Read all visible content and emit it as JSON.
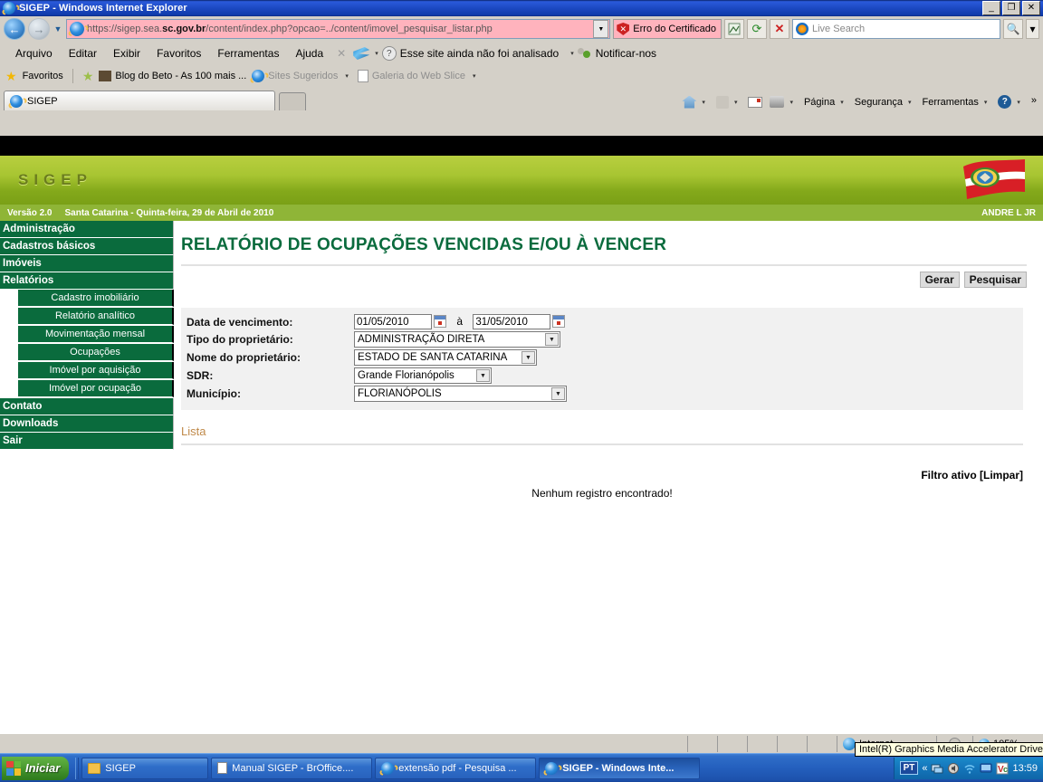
{
  "window": {
    "title": "SIGEP - Windows Internet Explorer",
    "minimize_label": "_",
    "restore_label": "❐",
    "close_label": "✕"
  },
  "browser": {
    "back_label": "←",
    "forward_label": "→",
    "history_caret": "▼",
    "url_prefix": "https://sigep.sea.",
    "url_host_bold": "sc.gov.br",
    "url_suffix": "/content/index.php?opcao=../content/imovel_pesquisar_listar.php",
    "url_dropdown": "▼",
    "certificate_error": "Erro do Certificado",
    "compat_icon": "compatibility-view-icon",
    "refresh_icon": "↻",
    "stop_icon": "✕",
    "search_placeholder": "Live Search",
    "search_go": "🔍",
    "search_caret": "▾",
    "menu": [
      "Arquivo",
      "Editar",
      "Exibir",
      "Favoritos",
      "Ferramentas",
      "Ajuda"
    ],
    "toolbar_close": "✕",
    "site_rating": "Esse site ainda não foi analisado",
    "notify_us": "Notificar-nos",
    "favorites_label": "Favoritos",
    "favorites_items": [
      "Blog do Beto - As 100 mais ...",
      "Sites Sugeridos",
      "Galeria do Web Slice"
    ],
    "tab_title": "SIGEP",
    "new_tab_label": "",
    "command_bar": [
      "Página",
      "Segurança",
      "Ferramentas"
    ],
    "command_overflow": "»"
  },
  "app": {
    "logo": "SIGEP",
    "version": "Versão 2.0",
    "location_date": "Santa Catarina - Quinta-feira, 29 de Abril de 2010",
    "user": "ANDRE L JR"
  },
  "sidebar": {
    "items": [
      {
        "label": "Administração"
      },
      {
        "label": "Cadastros básicos"
      },
      {
        "label": "Imóveis"
      },
      {
        "label": "Relatórios"
      }
    ],
    "submenu": [
      {
        "label": "Cadastro imobiliário"
      },
      {
        "label": "Relatório analítico"
      },
      {
        "label": "Movimentação mensal"
      },
      {
        "label": "Ocupações"
      },
      {
        "label": "Imóvel por aquisição"
      },
      {
        "label": "Imóvel por ocupação"
      }
    ],
    "bottom_items": [
      {
        "label": "Contato"
      },
      {
        "label": "Downloads"
      },
      {
        "label": "Sair"
      }
    ]
  },
  "main": {
    "title": "RELATÓRIO DE OCUPAÇÕES VENCIDAS E/OU À VENCER",
    "buttons": {
      "gerar": "Gerar",
      "pesquisar": "Pesquisar"
    },
    "form": {
      "date_label": "Data de vencimento:",
      "date_from": "01/05/2010",
      "date_separator": "à",
      "date_to": "31/05/2010",
      "owner_type_label": "Tipo do proprietário:",
      "owner_type_value": "ADMINISTRAÇÃO DIRETA",
      "owner_name_label": "Nome do proprietário:",
      "owner_name_value": "ESTADO DE SANTA CATARINA",
      "sdr_label": "SDR:",
      "sdr_value": "Grande Florianópolis",
      "municipality_label": "Município:",
      "municipality_value": "FLORIANÓPOLIS",
      "select_arrow": "▼"
    },
    "list_label": "Lista",
    "active_filter": "Filtro ativo [Limpar]",
    "no_records": "Nenhum registro encontrado!"
  },
  "statusbar": {
    "zone": "Internet",
    "zoom": "105%",
    "tooltip": "Intel(R) Graphics Media Accelerator Driver"
  },
  "taskbar": {
    "start": "Iniciar",
    "items": [
      {
        "label": "SIGEP",
        "icon": "folder-icon"
      },
      {
        "label": "Manual SIGEP - BrOffice....",
        "icon": "document-icon"
      },
      {
        "label": "extensão pdf - Pesquisa ...",
        "icon": "ie-icon"
      },
      {
        "label": "SIGEP - Windows Inte...",
        "icon": "ie-icon"
      }
    ],
    "language": "PT",
    "tray_expand": "«",
    "clock": "13:59"
  }
}
